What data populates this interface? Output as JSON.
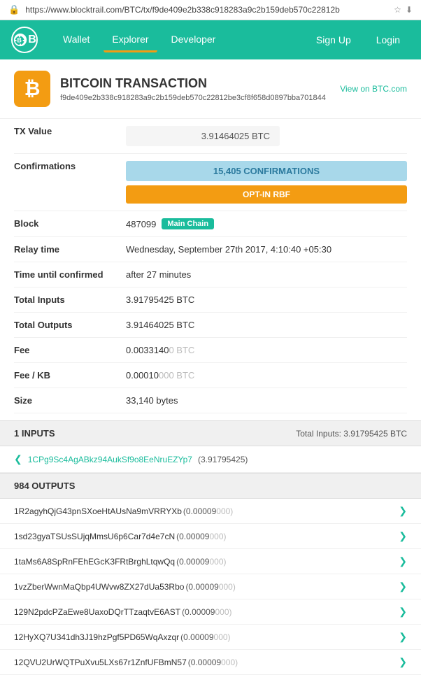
{
  "url": {
    "protocol_icon": "🔒",
    "text": "https://www.blocktrail.com/BTC/tx/f9de409e2b338c918283a9c2b159deb570c22812b",
    "star_icon": "★",
    "download_icon": "⬇"
  },
  "navbar": {
    "wallet_label": "Wallet",
    "explorer_label": "Explorer",
    "developer_label": "Developer",
    "signup_label": "Sign Up",
    "login_label": "Login"
  },
  "transaction": {
    "title": "BITCOIN TRANSACTION",
    "view_link": "View on BTC.com",
    "hash": "f9de409e2b338c918283a9c2b159deb570c22812be3cf8f658d0897bba701844",
    "btc_symbol": "₿",
    "fields": {
      "tx_value_label": "TX Value",
      "tx_value": "3.91464025 BTC",
      "confirmations_label": "Confirmations",
      "confirmations_value": "15,405 CONFIRMATIONS",
      "rbf_label": "OPT-IN RBF",
      "block_label": "Block",
      "block_number": "487099",
      "block_chain": "Main Chain",
      "relay_time_label": "Relay time",
      "relay_time_value": "Wednesday, September 27th 2017, 4:10:40 +05:30",
      "time_until_label": "Time until confirmed",
      "time_until_value": "after 27 minutes",
      "total_inputs_label": "Total Inputs",
      "total_inputs_value": "3.91795425 BTC",
      "total_outputs_label": "Total Outputs",
      "total_outputs_value": "3.91464025 BTC",
      "fee_label": "Fee",
      "fee_value": "0.0033140",
      "fee_dim": "0 BTC",
      "fee_kb_label": "Fee / KB",
      "fee_kb_value": "0.00010",
      "fee_kb_dim": "000 BTC",
      "size_label": "Size",
      "size_value": "33,140 bytes"
    }
  },
  "inputs_section": {
    "title": "1 INPUTS",
    "total": "Total Inputs: 3.91795425 BTC",
    "items": [
      {
        "address": "1CPg9Sc4AgABkz94AukSf9o8EeNruEZYp7",
        "amount": "(3.91795425)"
      }
    ]
  },
  "outputs_section": {
    "title": "984 OUTPUTS",
    "rows": [
      {
        "address": "1R2agyhQjG43pnSXoeHtAUsNa9mVRRYXb",
        "amount_main": "(0.00009",
        "amount_dim": "000)"
      },
      {
        "address": "1sd23gyaTSUsSUjqMmsU6p6Car7d4e7cN",
        "amount_main": "(0.00009",
        "amount_dim": "000)"
      },
      {
        "address": "1taMs6A8SpRnFEhEGcK3FRtBrghLtqwQq",
        "amount_main": "(0.00009",
        "amount_dim": "000)"
      },
      {
        "address": "1vzZberWwnMaQbp4UWvw8ZX27dUa53Rbo",
        "amount_main": "(0.00009",
        "amount_dim": "000)"
      },
      {
        "address": "129N2pdcPZaEwe8UaxoDQrTTzaqtvE6AST",
        "amount_main": "(0.00009",
        "amount_dim": "000)"
      },
      {
        "address": "12HyXQ7U341dh3J19hzPgf5PD65WqAxzqr",
        "amount_main": "(0.00009",
        "amount_dim": "000)"
      },
      {
        "address": "12QVU2UrWQTPuXvu5LXs67r1ZnfUFBmN57",
        "amount_main": "(0.00009",
        "amount_dim": "000)"
      }
    ]
  }
}
